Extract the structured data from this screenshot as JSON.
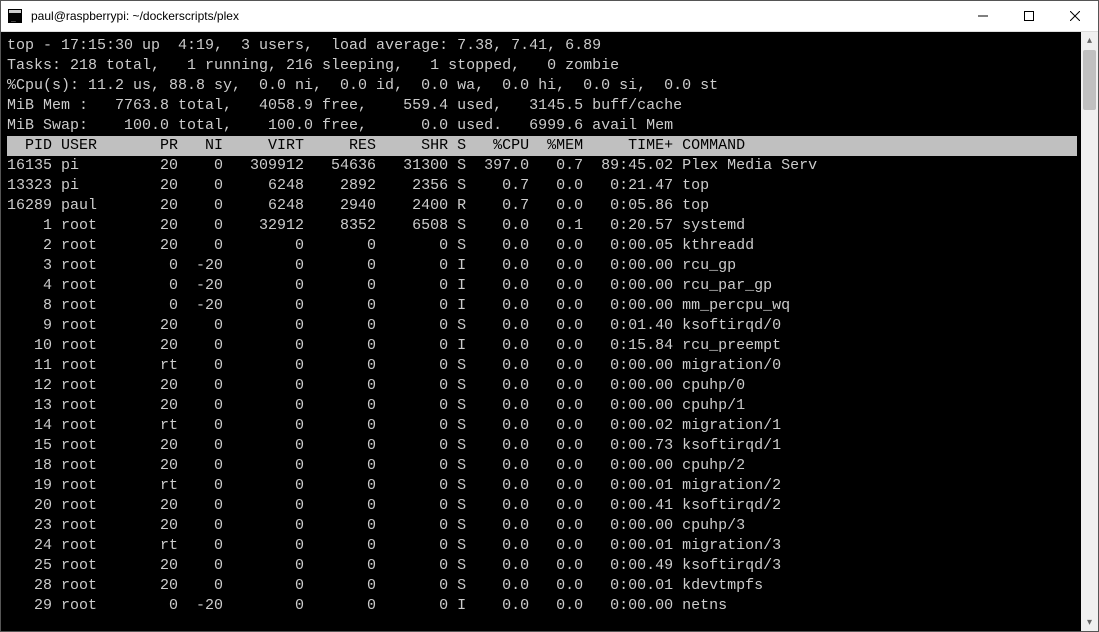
{
  "window": {
    "title": "paul@raspberrypi: ~/dockerscripts/plex"
  },
  "summary": {
    "line1": "top - 17:15:30 up  4:19,  3 users,  load average: 7.38, 7.41, 6.89",
    "line2": "Tasks: 218 total,   1 running, 216 sleeping,   1 stopped,   0 zombie",
    "line3": "%Cpu(s): 11.2 us, 88.8 sy,  0.0 ni,  0.0 id,  0.0 wa,  0.0 hi,  0.0 si,  0.0 st",
    "line4": "MiB Mem :   7763.8 total,   4058.9 free,    559.4 used,   3145.5 buff/cache",
    "line5": "MiB Swap:    100.0 total,    100.0 free,      0.0 used.   6999.6 avail Mem"
  },
  "columns": [
    "PID",
    "USER",
    "PR",
    "NI",
    "VIRT",
    "RES",
    "SHR",
    "S",
    "%CPU",
    "%MEM",
    "TIME+",
    "COMMAND"
  ],
  "rows": [
    {
      "pid": "16135",
      "user": "pi",
      "pr": "20",
      "ni": "0",
      "virt": "309912",
      "res": "54636",
      "shr": "31300",
      "s": "S",
      "cpu": "397.0",
      "mem": "0.7",
      "time": "89:45.02",
      "cmd": "Plex Media Serv"
    },
    {
      "pid": "13323",
      "user": "pi",
      "pr": "20",
      "ni": "0",
      "virt": "6248",
      "res": "2892",
      "shr": "2356",
      "s": "S",
      "cpu": "0.7",
      "mem": "0.0",
      "time": "0:21.47",
      "cmd": "top"
    },
    {
      "pid": "16289",
      "user": "paul",
      "pr": "20",
      "ni": "0",
      "virt": "6248",
      "res": "2940",
      "shr": "2400",
      "s": "R",
      "cpu": "0.7",
      "mem": "0.0",
      "time": "0:05.86",
      "cmd": "top"
    },
    {
      "pid": "1",
      "user": "root",
      "pr": "20",
      "ni": "0",
      "virt": "32912",
      "res": "8352",
      "shr": "6508",
      "s": "S",
      "cpu": "0.0",
      "mem": "0.1",
      "time": "0:20.57",
      "cmd": "systemd"
    },
    {
      "pid": "2",
      "user": "root",
      "pr": "20",
      "ni": "0",
      "virt": "0",
      "res": "0",
      "shr": "0",
      "s": "S",
      "cpu": "0.0",
      "mem": "0.0",
      "time": "0:00.05",
      "cmd": "kthreadd"
    },
    {
      "pid": "3",
      "user": "root",
      "pr": "0",
      "ni": "-20",
      "virt": "0",
      "res": "0",
      "shr": "0",
      "s": "I",
      "cpu": "0.0",
      "mem": "0.0",
      "time": "0:00.00",
      "cmd": "rcu_gp"
    },
    {
      "pid": "4",
      "user": "root",
      "pr": "0",
      "ni": "-20",
      "virt": "0",
      "res": "0",
      "shr": "0",
      "s": "I",
      "cpu": "0.0",
      "mem": "0.0",
      "time": "0:00.00",
      "cmd": "rcu_par_gp"
    },
    {
      "pid": "8",
      "user": "root",
      "pr": "0",
      "ni": "-20",
      "virt": "0",
      "res": "0",
      "shr": "0",
      "s": "I",
      "cpu": "0.0",
      "mem": "0.0",
      "time": "0:00.00",
      "cmd": "mm_percpu_wq"
    },
    {
      "pid": "9",
      "user": "root",
      "pr": "20",
      "ni": "0",
      "virt": "0",
      "res": "0",
      "shr": "0",
      "s": "S",
      "cpu": "0.0",
      "mem": "0.0",
      "time": "0:01.40",
      "cmd": "ksoftirqd/0"
    },
    {
      "pid": "10",
      "user": "root",
      "pr": "20",
      "ni": "0",
      "virt": "0",
      "res": "0",
      "shr": "0",
      "s": "I",
      "cpu": "0.0",
      "mem": "0.0",
      "time": "0:15.84",
      "cmd": "rcu_preempt"
    },
    {
      "pid": "11",
      "user": "root",
      "pr": "rt",
      "ni": "0",
      "virt": "0",
      "res": "0",
      "shr": "0",
      "s": "S",
      "cpu": "0.0",
      "mem": "0.0",
      "time": "0:00.00",
      "cmd": "migration/0"
    },
    {
      "pid": "12",
      "user": "root",
      "pr": "20",
      "ni": "0",
      "virt": "0",
      "res": "0",
      "shr": "0",
      "s": "S",
      "cpu": "0.0",
      "mem": "0.0",
      "time": "0:00.00",
      "cmd": "cpuhp/0"
    },
    {
      "pid": "13",
      "user": "root",
      "pr": "20",
      "ni": "0",
      "virt": "0",
      "res": "0",
      "shr": "0",
      "s": "S",
      "cpu": "0.0",
      "mem": "0.0",
      "time": "0:00.00",
      "cmd": "cpuhp/1"
    },
    {
      "pid": "14",
      "user": "root",
      "pr": "rt",
      "ni": "0",
      "virt": "0",
      "res": "0",
      "shr": "0",
      "s": "S",
      "cpu": "0.0",
      "mem": "0.0",
      "time": "0:00.02",
      "cmd": "migration/1"
    },
    {
      "pid": "15",
      "user": "root",
      "pr": "20",
      "ni": "0",
      "virt": "0",
      "res": "0",
      "shr": "0",
      "s": "S",
      "cpu": "0.0",
      "mem": "0.0",
      "time": "0:00.73",
      "cmd": "ksoftirqd/1"
    },
    {
      "pid": "18",
      "user": "root",
      "pr": "20",
      "ni": "0",
      "virt": "0",
      "res": "0",
      "shr": "0",
      "s": "S",
      "cpu": "0.0",
      "mem": "0.0",
      "time": "0:00.00",
      "cmd": "cpuhp/2"
    },
    {
      "pid": "19",
      "user": "root",
      "pr": "rt",
      "ni": "0",
      "virt": "0",
      "res": "0",
      "shr": "0",
      "s": "S",
      "cpu": "0.0",
      "mem": "0.0",
      "time": "0:00.01",
      "cmd": "migration/2"
    },
    {
      "pid": "20",
      "user": "root",
      "pr": "20",
      "ni": "0",
      "virt": "0",
      "res": "0",
      "shr": "0",
      "s": "S",
      "cpu": "0.0",
      "mem": "0.0",
      "time": "0:00.41",
      "cmd": "ksoftirqd/2"
    },
    {
      "pid": "23",
      "user": "root",
      "pr": "20",
      "ni": "0",
      "virt": "0",
      "res": "0",
      "shr": "0",
      "s": "S",
      "cpu": "0.0",
      "mem": "0.0",
      "time": "0:00.00",
      "cmd": "cpuhp/3"
    },
    {
      "pid": "24",
      "user": "root",
      "pr": "rt",
      "ni": "0",
      "virt": "0",
      "res": "0",
      "shr": "0",
      "s": "S",
      "cpu": "0.0",
      "mem": "0.0",
      "time": "0:00.01",
      "cmd": "migration/3"
    },
    {
      "pid": "25",
      "user": "root",
      "pr": "20",
      "ni": "0",
      "virt": "0",
      "res": "0",
      "shr": "0",
      "s": "S",
      "cpu": "0.0",
      "mem": "0.0",
      "time": "0:00.49",
      "cmd": "ksoftirqd/3"
    },
    {
      "pid": "28",
      "user": "root",
      "pr": "20",
      "ni": "0",
      "virt": "0",
      "res": "0",
      "shr": "0",
      "s": "S",
      "cpu": "0.0",
      "mem": "0.0",
      "time": "0:00.01",
      "cmd": "kdevtmpfs"
    },
    {
      "pid": "29",
      "user": "root",
      "pr": "0",
      "ni": "-20",
      "virt": "0",
      "res": "0",
      "shr": "0",
      "s": "I",
      "cpu": "0.0",
      "mem": "0.0",
      "time": "0:00.00",
      "cmd": "netns"
    }
  ]
}
